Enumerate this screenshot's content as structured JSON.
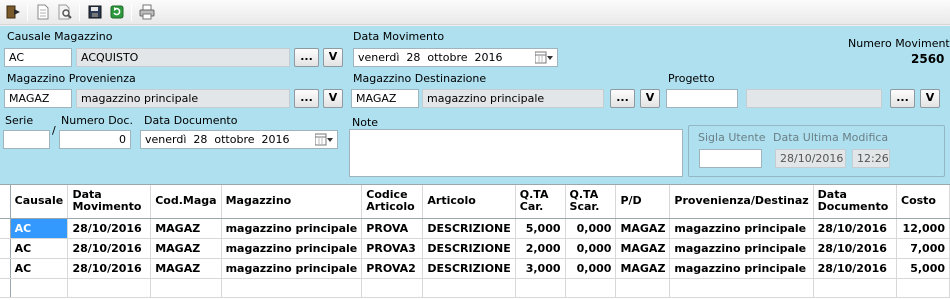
{
  "toolbar": {
    "icons": [
      "exit-icon",
      "new-document-icon",
      "search-document-icon",
      "save-icon",
      "refresh-icon",
      "print-icon"
    ]
  },
  "form": {
    "causale": {
      "label": "Causale Magazzino",
      "code": "AC",
      "description": "ACQUISTO"
    },
    "data_movimento": {
      "label": "Data Movimento",
      "day": "venerdì",
      "date": "28",
      "month": "ottobre",
      "year": "2016"
    },
    "numero_movimento": {
      "label": "Numero Movimento",
      "value": "2560"
    },
    "provenienza": {
      "label": "Magazzino Provenienza",
      "code": "MAGAZ",
      "description": "magazzino principale"
    },
    "destinazione": {
      "label": "Magazzino Destinazione",
      "code": "MAGAZ",
      "description": "magazzino principale"
    },
    "progetto": {
      "label": "Progetto",
      "code": "",
      "description": ""
    },
    "serie": {
      "label": "Serie",
      "value": ""
    },
    "numero_doc": {
      "label": "Numero Doc.",
      "slash": "/",
      "value": "0"
    },
    "data_documento": {
      "label": "Data Documento",
      "day": "venerdì",
      "date": "28",
      "month": "ottobre",
      "year": "2016"
    },
    "note": {
      "label": "Note",
      "value": ""
    },
    "sigla_utente": {
      "label": "Sigla Utente",
      "value": ""
    },
    "data_ultima_modifica": {
      "label": "Data Ultima Modifica",
      "date": "28/10/2016",
      "time": "12:26"
    },
    "buttons": {
      "ellipsis": "...",
      "v": "V"
    }
  },
  "grid": {
    "columns": [
      "Causale",
      "Data Movimento",
      "Cod.Maga",
      "Magazzino",
      "Codice Articolo",
      "Articolo",
      "Q.TA Car.",
      "Q.TA Scar.",
      "P/D",
      "Provenienza/Destinaz",
      "Data Documento",
      "Costo"
    ],
    "rows": [
      [
        "AC",
        "28/10/2016",
        "MAGAZ",
        "magazzino principale",
        "PROVA",
        "DESCRIZIONE",
        "5,000",
        "0,000",
        "MAGAZ",
        "magazzino principale",
        "28/10/2016",
        "12,000"
      ],
      [
        "AC",
        "28/10/2016",
        "MAGAZ",
        "magazzino principale",
        "PROVA3",
        "DESCRIZIONE",
        "2,000",
        "0,000",
        "MAGAZ",
        "magazzino principale",
        "28/10/2016",
        "7,000"
      ],
      [
        "AC",
        "28/10/2016",
        "MAGAZ",
        "magazzino principale",
        "PROVA2",
        "DESCRIZIONE",
        "3,000",
        "0,000",
        "MAGAZ",
        "magazzino principale",
        "28/10/2016",
        "5,000"
      ]
    ],
    "selection_color": "#3399ff"
  }
}
